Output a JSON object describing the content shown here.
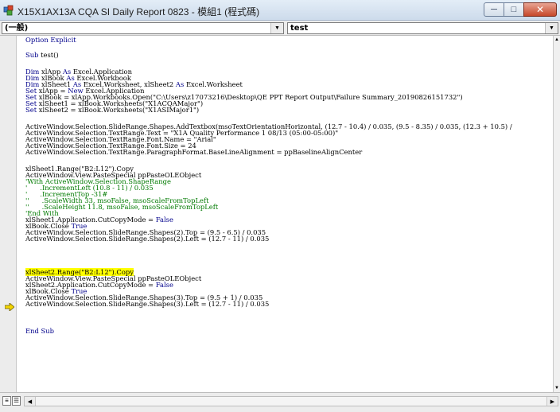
{
  "window": {
    "title": "X15X1AX13A  CQA SI Daily Report 0823 - 模組1 (程式碼)",
    "minimize_glyph": "─",
    "maximize_glyph": "□",
    "close_glyph": "✕"
  },
  "combos": {
    "object": {
      "value": "(一般)"
    },
    "procedure": {
      "value": "test"
    }
  },
  "code": {
    "lines": [
      {
        "text": "Option Explicit",
        "kind": "kw"
      },
      {
        "text": "Sub test()",
        "kind": "mixed"
      },
      {
        "text": "Dim xlApp As Excel.Application",
        "kind": "mixed"
      },
      {
        "text": "Dim xlBook As Excel.Workbook",
        "kind": "mixed"
      },
      {
        "text": "Dim xlSheet1 As Excel.Worksheet, xlSheet2 As Excel.Worksheet",
        "kind": "mixed"
      },
      {
        "text": "Set xlApp = New Excel.Application",
        "kind": "mixed"
      },
      {
        "text": "Set xlBook = xlApp.Workbooks.Open(\"C:\\Users\\z17073216\\Desktop\\QE PPT Report Output\\Failure Summary_20190826151732\")",
        "kind": "mixed"
      },
      {
        "text": "Set xlSheet1 = xlBook.Worksheets(\"X1ACQAMajor\")",
        "kind": "mixed"
      },
      {
        "text": "Set xlSheet2 = xlBook.Worksheets(\"X1ASIMajor1\")",
        "kind": "mixed"
      },
      {
        "text": "ActiveWindow.Selection.SlideRange.Shapes.AddTextbox(msoTextOrientationHorizontal, (12.7 - 10.4) / 0.035, (9.5 - 8.35) / 0.035, (12.3 + 10.5) /",
        "kind": "plain"
      },
      {
        "text": "ActiveWindow.Selection.TextRange.Text = \"X1A Quality Performance 1 08/13 (05:00-05:00)\"",
        "kind": "plain"
      },
      {
        "text": "ActiveWindow.Selection.TextRange.Font.Name = \"Arial\"",
        "kind": "plain"
      },
      {
        "text": "ActiveWindow.Selection.TextRange.Font.Size = 24",
        "kind": "plain"
      },
      {
        "text": "ActiveWindow.Selection.TextRange.ParagraphFormat.BaseLineAlignment = ppBaselineAlignCenter",
        "kind": "plain"
      },
      {
        "text": "xlSheet1.Range(\"B2:L12\").Copy",
        "kind": "plain"
      },
      {
        "text": "ActiveWindow.View.PasteSpecial ppPasteOLEObject",
        "kind": "plain"
      },
      {
        "text": "'With ActiveWindow.Selection.ShapeRange",
        "kind": "cm"
      },
      {
        "text": "'      .IncrementLeft (10.8 - 11) / 0.035",
        "kind": "cm"
      },
      {
        "text": "'      .IncrementTop -31#",
        "kind": "cm"
      },
      {
        "text": "''      .ScaleWidth 33, msoFalse, msoScaleFromTopLeft",
        "kind": "cm"
      },
      {
        "text": "''      .ScaleHeight 11.8, msoFalse, msoScaleFromTopLeft",
        "kind": "cm"
      },
      {
        "text": "'End With",
        "kind": "cm"
      },
      {
        "text": "xlSheet1.Application.CutCopyMode = False",
        "kind": "mixed"
      },
      {
        "text": "xlBook.Close True",
        "kind": "mixed"
      },
      {
        "text": "ActiveWindow.Selection.SlideRange.Shapes(2).Top = (9.5 - 6.5) / 0.035",
        "kind": "plain"
      },
      {
        "text": "ActiveWindow.Selection.SlideRange.Shapes(2).Left = (12.7 - 11) / 0.035",
        "kind": "plain"
      },
      {
        "text": "xlSheet2.Range(\"B2:L12\").Copy",
        "kind": "hl"
      },
      {
        "text": "ActiveWindow.View.PasteSpecial ppPasteOLEObject",
        "kind": "plain"
      },
      {
        "text": "xlSheet2.Application.CutCopyMode = False",
        "kind": "mixed"
      },
      {
        "text": "xlBook.Close True",
        "kind": "mixed"
      },
      {
        "text": "ActiveWindow.Selection.SlideRange.Shapes(3).Top = (9.5 + 1) / 0.035",
        "kind": "plain"
      },
      {
        "text": "ActiveWindow.Selection.SlideRange.Shapes(3).Left = (12.7 - 11) / 0.035",
        "kind": "plain"
      },
      {
        "text": "End Sub",
        "kind": "kw"
      }
    ]
  },
  "colors": {
    "keyword": "#00008b",
    "comment": "#007a00",
    "highlight": "#ffff00",
    "exec_arrow": "#f2d400"
  },
  "icons": {
    "app": "vba-project-icon",
    "exec": "execution-point-arrow-icon",
    "view_procedure": "procedure-view-icon",
    "view_module": "full-module-view-icon"
  }
}
